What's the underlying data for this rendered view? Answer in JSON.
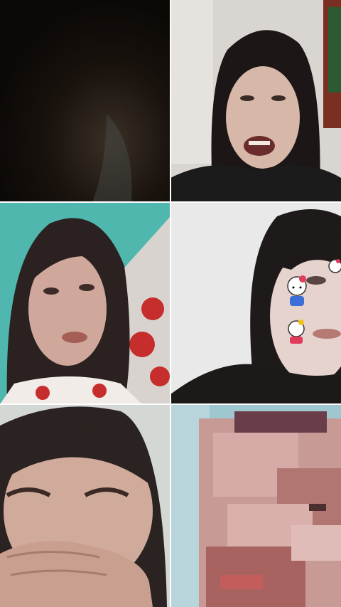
{
  "app": {
    "layout": "video-call-grid",
    "columns": 2,
    "rows": 3
  },
  "participants": [
    {
      "id": "p1",
      "video_state": "dark",
      "icon": "video-tile-dark"
    },
    {
      "id": "p2",
      "video_state": "on",
      "icon": "video-tile"
    },
    {
      "id": "p3",
      "video_state": "on",
      "icon": "video-tile"
    },
    {
      "id": "p4",
      "video_state": "on",
      "icon": "video-tile"
    },
    {
      "id": "p5",
      "video_state": "on",
      "icon": "video-tile"
    },
    {
      "id": "p6",
      "video_state": "on",
      "icon": "video-tile"
    }
  ],
  "colors": {
    "divider": "#ffffff",
    "background": "#000000"
  }
}
